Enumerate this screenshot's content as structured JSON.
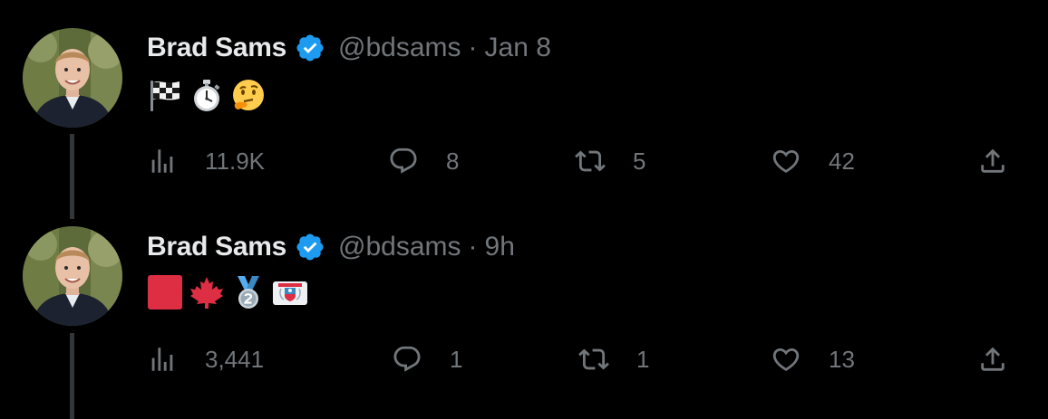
{
  "colors": {
    "background": "#000000",
    "primary_text": "#e7e9ea",
    "secondary_text": "#71767b",
    "verified_badge": "#1d9bf0",
    "thread_line": "#333639"
  },
  "tweets": [
    {
      "author": {
        "display_name": "Brad Sams",
        "handle": "@bdsams",
        "verified": true
      },
      "separator": "·",
      "time": "Jan 8",
      "content_emojis": [
        "chequered-flag",
        "stopwatch",
        "thinking-face"
      ],
      "stats": {
        "views": "11.9K",
        "replies": "8",
        "retweets": "5",
        "likes": "42"
      }
    },
    {
      "author": {
        "display_name": "Brad Sams",
        "handle": "@bdsams",
        "verified": true
      },
      "separator": "·",
      "time": "9h",
      "content_emojis": [
        "red-square",
        "maple-leaf",
        "second-place-medal",
        "flag-mayotte"
      ],
      "stats": {
        "views": "3,441",
        "replies": "1",
        "retweets": "1",
        "likes": "13"
      }
    }
  ]
}
